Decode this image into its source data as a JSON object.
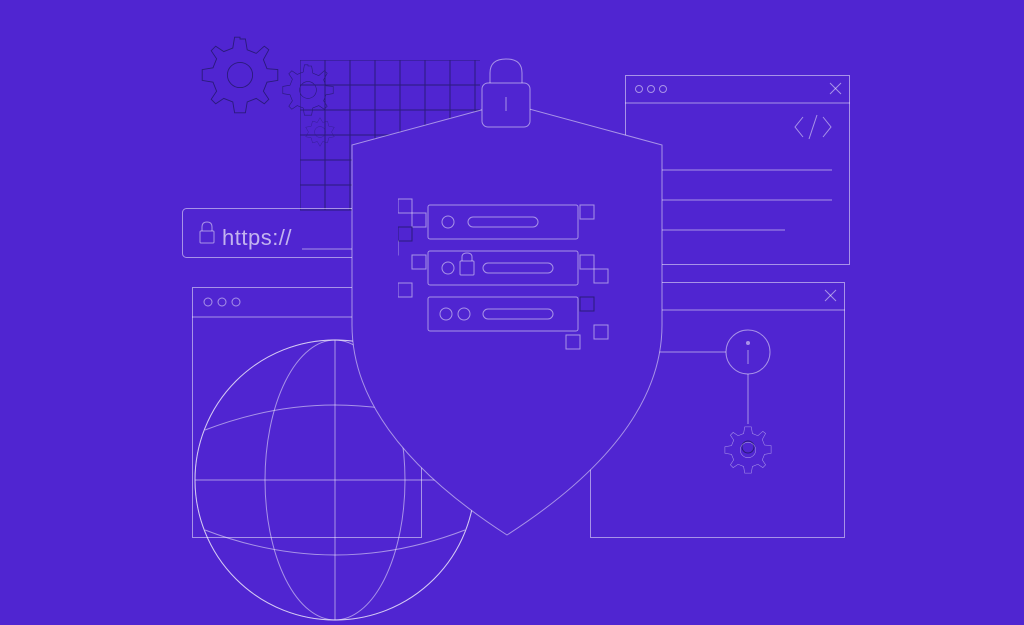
{
  "illustration": {
    "theme": "web-security",
    "background_color": "#5025D1",
    "line_color_light": "rgba(255,255,255,0.5)",
    "line_color_dark": "#2A1B7A",
    "address_bar": {
      "protocol_text": "https://"
    },
    "elements": [
      "shield",
      "padlock",
      "gears",
      "grid",
      "globe",
      "browser-window",
      "code-window",
      "info-window",
      "address-bar",
      "server-stack"
    ]
  }
}
